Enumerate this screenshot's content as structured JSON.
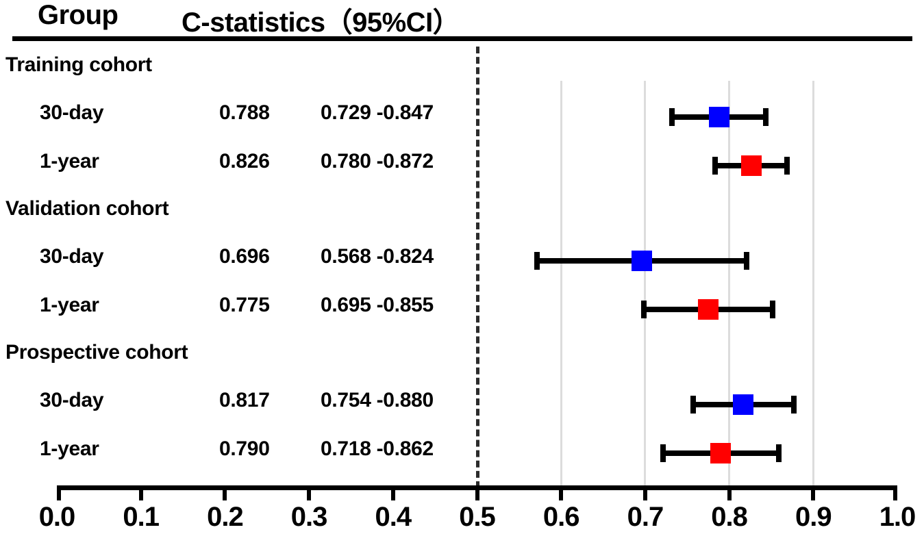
{
  "header": {
    "group_label": "Group",
    "cstat_label": "C-statistics（95%CI）"
  },
  "chart_data": {
    "type": "forest",
    "title": "C-statistics（95%CI）",
    "xlabel": "",
    "ylabel": "",
    "xlim": [
      0.0,
      1.0
    ],
    "xticks": [
      "0.0",
      "0.1",
      "0.2",
      "0.3",
      "0.4",
      "0.5",
      "0.6",
      "0.7",
      "0.8",
      "0.9",
      "1.0"
    ],
    "xtick_values": [
      0.0,
      0.1,
      0.2,
      0.3,
      0.4,
      0.5,
      0.6,
      0.7,
      0.8,
      0.9,
      1.0
    ],
    "grid": true,
    "gridline_values": [
      0.6,
      0.7,
      0.8,
      0.9
    ],
    "reference_line": 0.5,
    "reference_line_style": "dashed",
    "legend": [],
    "colors": {
      "marker_30day": "#0000ff",
      "marker_1year": "#ff0000",
      "ci_line": "#000000",
      "gridline": "#dcdcdc",
      "reference_line": "#2b2b2b"
    },
    "groups": [
      {
        "name": "Training cohort",
        "rows": [
          {
            "label": "30-day",
            "estimate": 0.788,
            "estimate_text": "0.788",
            "ci_low": 0.729,
            "ci_high": 0.847,
            "ci_text": "0.729 -0.847",
            "color": "#0000ff"
          },
          {
            "label": "1-year",
            "estimate": 0.826,
            "estimate_text": "0.826",
            "ci_low": 0.78,
            "ci_high": 0.872,
            "ci_text": "0.780 -0.872",
            "color": "#ff0000"
          }
        ]
      },
      {
        "name": "Validation cohort",
        "rows": [
          {
            "label": "30-day",
            "estimate": 0.696,
            "estimate_text": "0.696",
            "ci_low": 0.568,
            "ci_high": 0.824,
            "ci_text": "0.568 -0.824",
            "color": "#0000ff"
          },
          {
            "label": "1-year",
            "estimate": 0.775,
            "estimate_text": "0.775",
            "ci_low": 0.695,
            "ci_high": 0.855,
            "ci_text": "0.695 -0.855",
            "color": "#ff0000"
          }
        ]
      },
      {
        "name": "Prospective cohort",
        "rows": [
          {
            "label": "30-day",
            "estimate": 0.817,
            "estimate_text": "0.817",
            "ci_low": 0.754,
            "ci_high": 0.88,
            "ci_text": "0.754 -0.880",
            "color": "#0000ff"
          },
          {
            "label": "1-year",
            "estimate": 0.79,
            "estimate_text": "0.790",
            "ci_low": 0.718,
            "ci_high": 0.862,
            "ci_text": "0.718 -0.862",
            "color": "#ff0000"
          }
        ]
      }
    ]
  }
}
